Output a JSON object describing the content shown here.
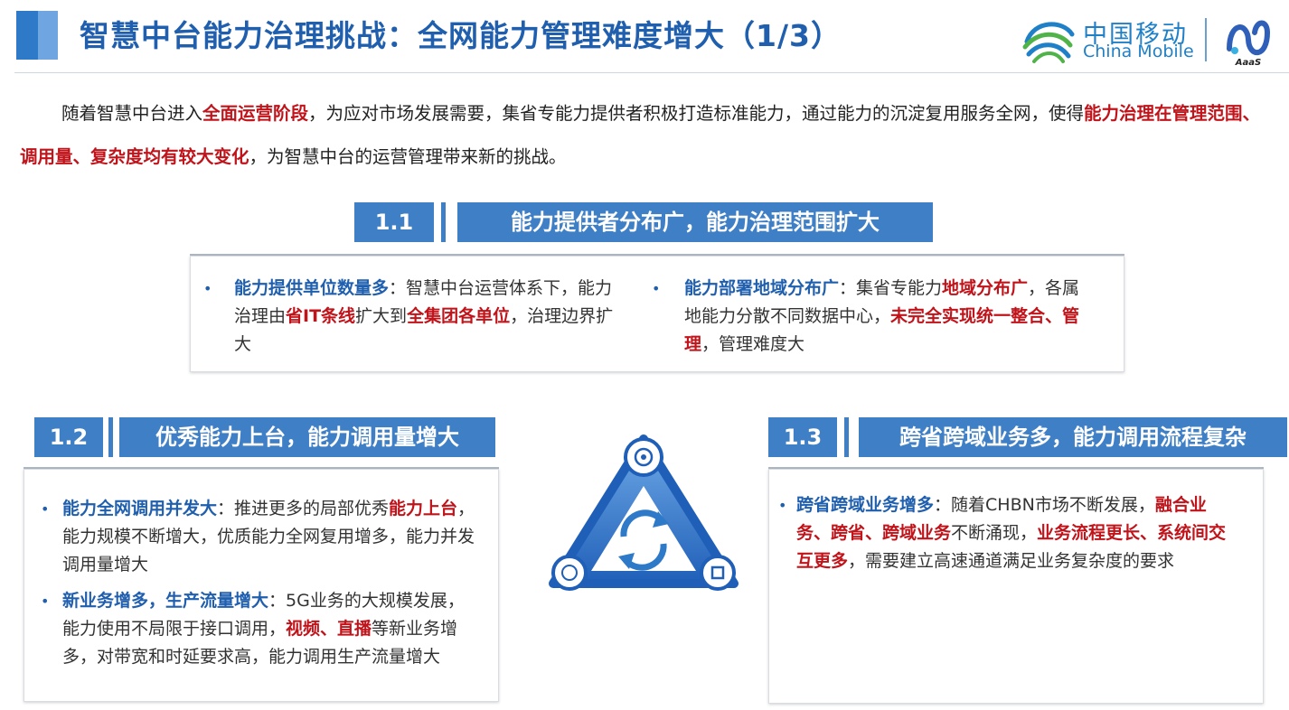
{
  "header": {
    "title": "智慧中台能力治理挑战：全网能力管理难度增大（1/3）",
    "logo_cn": "中国移动",
    "logo_en": "China Mobile",
    "aaas_label": "AaaS"
  },
  "intro": {
    "p1": "随着智慧中台进入",
    "h1": "全面运营阶段",
    "p2": "，为应对市场发展需要，集省专能力提供者积极打造标准能力，通过能力的沉淀复用服务全网，使得",
    "h2": "能力治理在管理范围、调用量、复杂度均有较大变化",
    "p3": "，为智慧中台的运营管理带来新的挑战。"
  },
  "s11": {
    "num": "1.1",
    "title": "能力提供者分布广，能力治理范围扩大",
    "left": {
      "lead": "能力提供单位数量多",
      "t1": "：智慧中台运营体系下，能力治理由",
      "r1": "省IT条线",
      "t2": "扩大到",
      "r2": "全集团各单位",
      "t3": "，治理边界扩大"
    },
    "right": {
      "lead": "能力部署地域分布广",
      "t1": "：集省专能力",
      "r1": "地域分布广",
      "t2": "，各属地能力分散不同数据中心，",
      "r2": "未完全实现统一整合、管理",
      "t3": "，管理难度大"
    }
  },
  "s12": {
    "num": "1.2",
    "title": "优秀能力上台，能力调用量增大",
    "b1": {
      "lead": "能力全网调用并发大",
      "t1": "：推进更多的局部优秀",
      "r1": "能力上台",
      "t2": "，能力规模不断增大，优质能力全网复用增多，能力并发调用量增大"
    },
    "b2": {
      "lead": "新业务增多，生产流量增大",
      "t1": "：5G业务的大规模发展，能力使用不局限于接口调用，",
      "r1": "视频、直播",
      "t2": "等新业务增多，对带宽和时延要求高，能力调用生产流量增大"
    }
  },
  "s13": {
    "num": "1.3",
    "title": "跨省跨域业务多，能力调用流程复杂",
    "b1": {
      "lead": "跨省跨域业务增多",
      "t1": "：随着CHBN市场不断发展，",
      "r1": "融合业务、跨省、跨域业务",
      "t2": "不断涌现，",
      "r2": "业务流程更长、系统间交互更多",
      "t3": "，需要建立高速通道满足业务复杂度的要求"
    }
  },
  "colors": {
    "accent_blue": "#3f7fc6",
    "title_blue": "#1f5fae",
    "highlight_red": "#c0131a"
  }
}
